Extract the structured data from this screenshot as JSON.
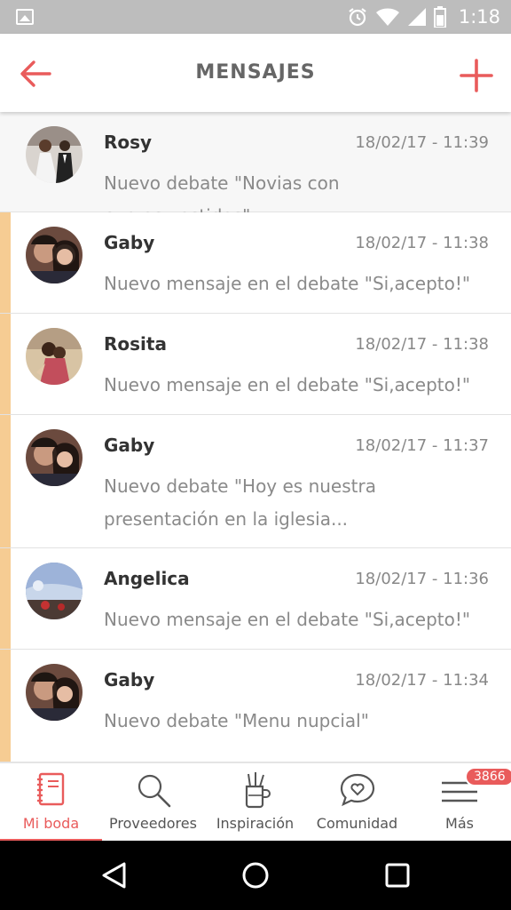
{
  "status_bar": {
    "time": "1:18"
  },
  "header": {
    "title": "MENSAJES"
  },
  "messages": [
    {
      "name": "Rosy",
      "date": "18/02/17 - 11:39",
      "text": "Nuevo debate \"Novias con curvas,vestidos\"",
      "unread": false
    },
    {
      "name": "Gaby",
      "date": "18/02/17 - 11:38",
      "text": "Nuevo mensaje en el debate \"Si,acepto!\"",
      "unread": true
    },
    {
      "name": "Rosita",
      "date": "18/02/17 - 11:38",
      "text": "Nuevo mensaje en el debate \"Si,acepto!\"",
      "unread": true
    },
    {
      "name": "Gaby",
      "date": "18/02/17 - 11:37",
      "text": "Nuevo debate \"Hoy es nuestra presentación en la iglesia...",
      "unread": true
    },
    {
      "name": "Angelica",
      "date": "18/02/17 - 11:36",
      "text": "Nuevo mensaje en el debate \"Si,acepto!\"",
      "unread": true
    },
    {
      "name": "Gaby",
      "date": "18/02/17 - 11:34",
      "text": "Nuevo debate \"Menu nupcial\"",
      "unread": true
    }
  ],
  "bottom_nav": {
    "items": [
      {
        "label": "Mi boda",
        "icon": "notebook-icon"
      },
      {
        "label": "Proveedores",
        "icon": "search-icon"
      },
      {
        "label": "Inspiración",
        "icon": "jar-icon"
      },
      {
        "label": "Comunidad",
        "icon": "chat-heart-icon"
      },
      {
        "label": "Más",
        "icon": "menu-icon"
      }
    ],
    "badge": "3866"
  },
  "colors": {
    "accent": "#e95b5b",
    "unread_bar": "#f6cc93",
    "statusbar": "#bdbdbd"
  }
}
